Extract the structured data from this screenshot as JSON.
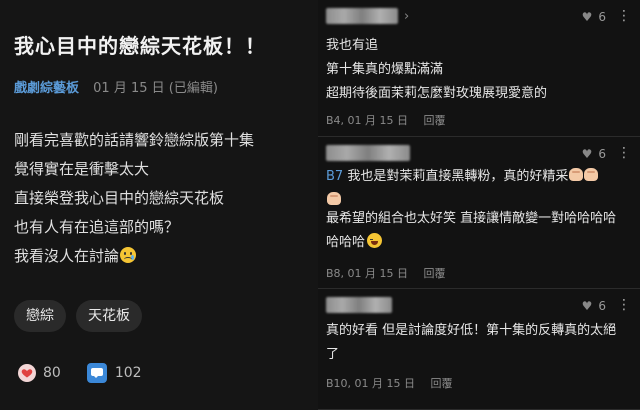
{
  "post": {
    "title": "我心目中的戀綜天花板！！",
    "board": "戲劇綜藝板",
    "date": "01 月 15 日 (已編輯)",
    "body_lines": [
      "剛看完喜歡的話請響鈴戀綜版第十集",
      "覺得實在是衝擊太大",
      "直接榮登我心目中的戀綜天花板",
      "也有人有在追這部的嗎？",
      "我看沒人在討論"
    ],
    "tags": [
      "戀綜",
      "天花板"
    ],
    "like_count": "80",
    "comment_count": "102",
    "colors": {
      "board": "#5b9bd8",
      "comment_icon": "#3b88d8"
    }
  },
  "comments": [
    {
      "likes": "6",
      "lines": [
        "我也有追",
        "第十集真的爆點滿滿",
        "超期待後面茉莉怎麼對玫瑰展現愛意的"
      ],
      "floor": "B4, 01 月 15 日",
      "reply_label": "回覆"
    },
    {
      "likes": "6",
      "reply_to": "B7",
      "lines": [
        "我也是對茉莉直接黑轉粉，真的好精采",
        "最希望的組合也太好笑 直接讓情敵變一對哈哈哈哈",
        "哈哈哈"
      ],
      "floor": "B8, 01 月 15 日",
      "reply_label": "回覆"
    },
    {
      "likes": "6",
      "lines": [
        "真的好看 但是討論度好低！第十集的反轉真的太絕",
        "了"
      ],
      "floor": "B10, 01 月 15 日",
      "reply_label": "回覆"
    }
  ]
}
